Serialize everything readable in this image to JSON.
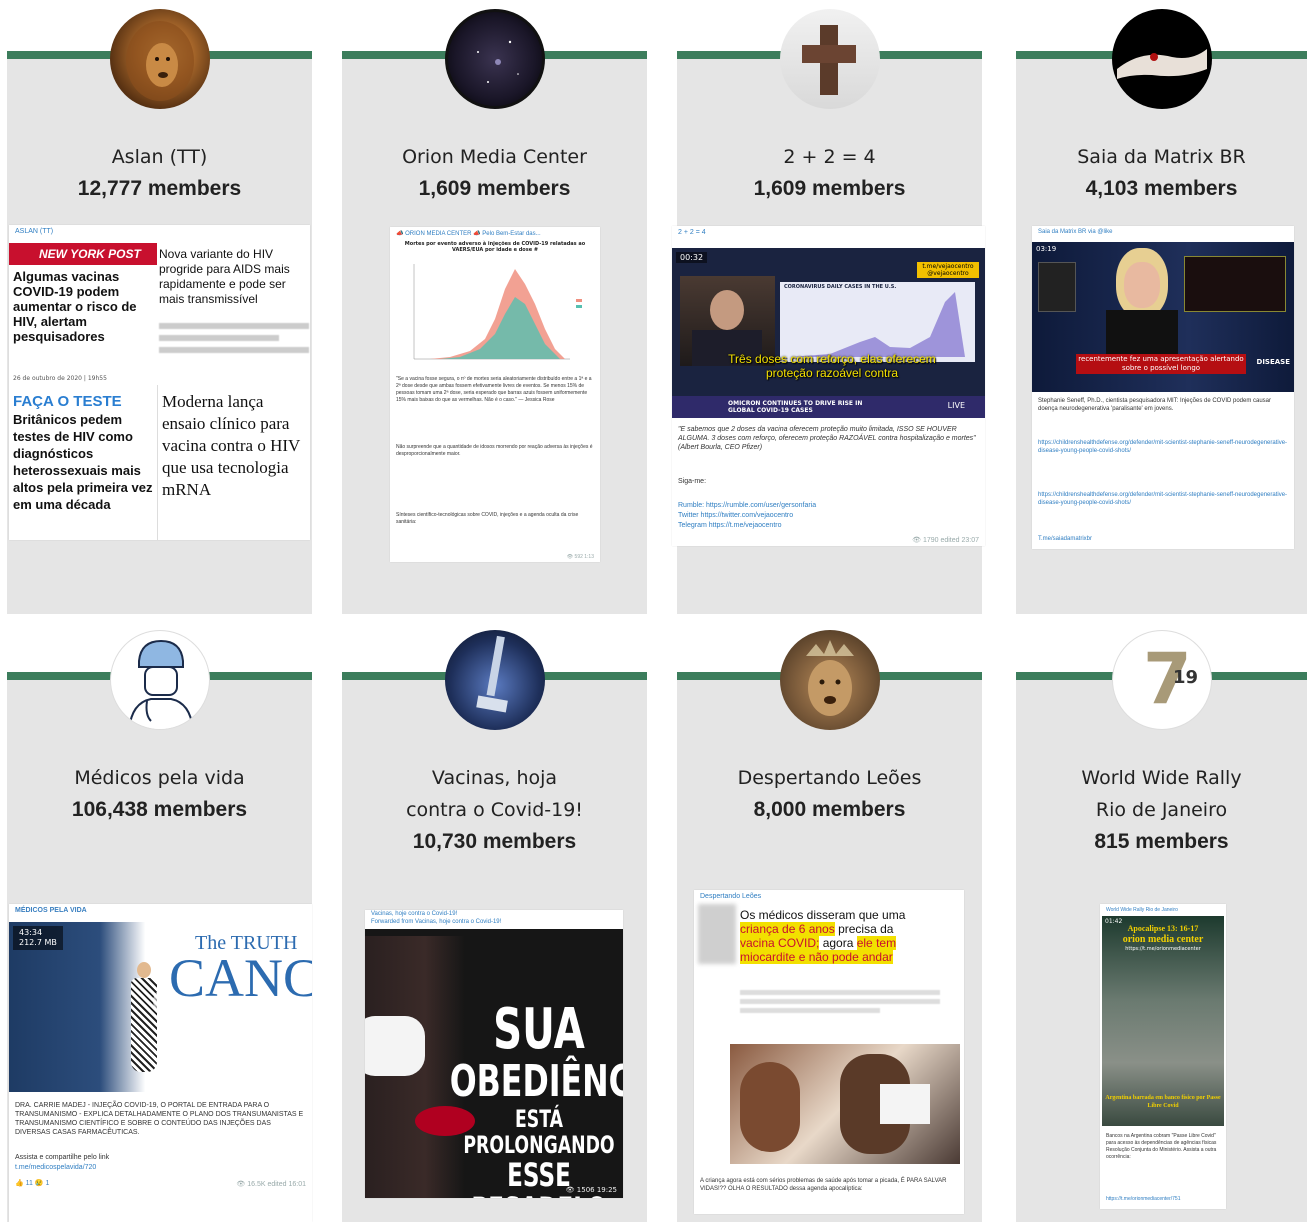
{
  "channels": [
    {
      "name_lines": [
        "Aslan (TT)"
      ],
      "members": "12,777 members"
    },
    {
      "name_lines": [
        "Orion Media Center"
      ],
      "members": "1,609 members"
    },
    {
      "name_lines": [
        "2 + 2 = 4"
      ],
      "members": "1,609 members"
    },
    {
      "name_lines": [
        "Saia da Matrix BR"
      ],
      "members": "4,103 members"
    },
    {
      "name_lines": [
        "Médicos pela vida"
      ],
      "members": "106,438 members"
    },
    {
      "name_lines": [
        "Vacinas, hoja",
        "contra o Covid-19!"
      ],
      "members": "10,730 members"
    },
    {
      "name_lines": [
        "Despertando Leões"
      ],
      "members": "8,000 members"
    },
    {
      "name_lines": [
        "World Wide Rally",
        "Rio de Janeiro"
      ],
      "members": "815 members"
    }
  ],
  "posts": {
    "aslan": {
      "channel": "ASLAN (TT)",
      "paper": "NEW YORK POST",
      "headline_left": "Algumas vacinas COVID-19 podem aumentar o risco de HIV, alertam pesquisadores",
      "date": "26 de outubro de 2020 | 19h55",
      "faca": "FAÇA O TESTE",
      "headline_left2": "Britânicos pedem testes de HIV como diagnósticos heterossexuais mais altos pela primeira vez em uma década",
      "headline_right": "Nova variante do HIV progride para AIDS mais rapidamente e pode ser mais transmissível",
      "headline_right2": "Moderna lança ensaio clínico para vacina contra o HIV que usa tecnologia mRNA"
    },
    "orion": {
      "header": "📣 ORION MEDIA CENTER 📣 Pelo Bem-Estar das...",
      "chart_title": "Mortes por evento adverso à injeções de COVID-19 relatadas ao VAERS/EUA por idade e dose #",
      "text1": "\"Se a vacina fosse segura, o nº de mortes seria aleatoriamente distribuído entre a 1ª e a 2ª dose desde que ambas fossem efetivamente livres de eventos. Se menos 15% de pessoas tomam uma 2ª dose, seria esperado que barras azuis fossem uniformemente 15% mais baixas do que as vermelhas. Não é o caso.\" — Jessica Rose",
      "text2": "Não surpreende que a quantidade de idosos morrendo por reação adversa às injeções é desproporcionalmente maior.",
      "text3": "Sínteses científico-tecnológicas sobre COVID, injeções e a agenda oculta da crise sanitária:",
      "meta": "👁 592  1:13"
    },
    "twoplus": {
      "header": "2 + 2 = 4",
      "time": "00:32",
      "handle": "t.me/vejaocentro @vejaocentro",
      "chart_label": "CORONAVIRUS DAILY CASES IN THE U.S.",
      "subtitle": "Três doses com reforço, elas oferecem proteção razoável contra",
      "ticker": "OMICRON CONTINUES TO DRIVE RISE IN GLOBAL COVID-19 CASES",
      "live": "LIVE",
      "quote": "\"E sabemos que 2 doses da vacina oferecem proteção muito limitada, ISSO SE HOUVER ALGUMA. 3 doses com reforço, oferecem proteção RAZOÁVEL contra hospitalização e mortes\" (Albert Bourla, CEO Pfizer)",
      "sigame": "Siga-me:",
      "rumble": "Rumble: https://rumble.com/user/gersonfaria",
      "twitter": "Twitter https://twitter.com/vejaocentro",
      "telegram": "Telegram https://t.me/vejaocentro",
      "meta": "👁 1790 edited 23:07"
    },
    "saia": {
      "header": "Saia da Matrix BR via @like",
      "time": "03:19",
      "subtitle": "recentemente fez uma apresentação alertando sobre o possível longo",
      "disease": "DISEASE",
      "text": "Stephanie Seneff, Ph.D., cientista pesquisadora MIT: Injeções de COVID podem causar doença neurodegenerativa 'paralisante' em jovens.",
      "link1": "https://childrenshealthdefense.org/defender/mit-scientist-stephanie-seneff-neurodegenerative-disease-young-people-covid-shots/",
      "link2": "https://childrenshealthdefense.org/defender/mit-scientist-stephanie-seneff-neurodegenerative-disease-young-people-covid-shots/",
      "footer": "T.me/saiadamatrixbr"
    },
    "medicos": {
      "channel": "MÉDICOS PELA VIDA",
      "time": "43:34",
      "size": "212.7 MB",
      "banner": "The TRUTH",
      "banner2": "CANC",
      "text": "DRA. CARRIE MADEJ - INJEÇÃO COVID-19, O PORTAL DE ENTRADA PARA O TRANSUMANISMO - EXPLICA DETALHADAMENTE O PLANO DOS TRANSUMANISTAS E TRANSUMANISMO CIENTÍFICO E SOBRE O CONTEÚDO DAS INJEÇÕES DAS DIVERSAS CASAS FARMACÊUTICAS.",
      "share": "Assista e compartilhe pelo link",
      "link": "t.me/medicospelavida/720",
      "reactions": "👍 11  😢 1",
      "meta": "👁 16.5K edited 16:01"
    },
    "vacinas": {
      "header1": "Vacinas, hoje contra o Covid-19!",
      "header2": "Forwarded from Vacinas, hoje contra o Covid-19!",
      "line1": "SUA",
      "line2": "OBEDIÊNCIA",
      "line3": "ESTÁ PROLONGANDO",
      "line4": "ESSE PESADELO",
      "meta": "👁 1506  19:25"
    },
    "leoes": {
      "header": "Despertando Leões",
      "text_a": "Os médicos disseram que uma ",
      "text_b": "criança de 6 anos",
      "text_c": " precisa da ",
      "text_d": "vacina COVID;",
      "text_e": " agora ",
      "text_f": "ele tem miocardite e não pode andar",
      "caption": "A criança agora está com sérios problemas de saúde após tomar a picada, É PARA SALVAR VIDAS!?? OLHA O RESULTADO dessa agenda apocalíptica:"
    },
    "rally": {
      "header": "World Wide Rally Rio de Janeiro",
      "time": "01:42",
      "title1": "Apocalipse 13: 16-17",
      "title2": "orion media center",
      "title3": "https://t.me/orionmediacenter",
      "bottom": "Argentina barrada em banco físico por Passe Libre Covid",
      "text": "Bancos na Argentina cobram \"Passe Libre Covid\" para acesso às dependências de agências físicas Resolução Conjunta do Ministério. Assista a outra ocorrência:",
      "link": "https://t.me/orionmediacenter/751"
    }
  }
}
